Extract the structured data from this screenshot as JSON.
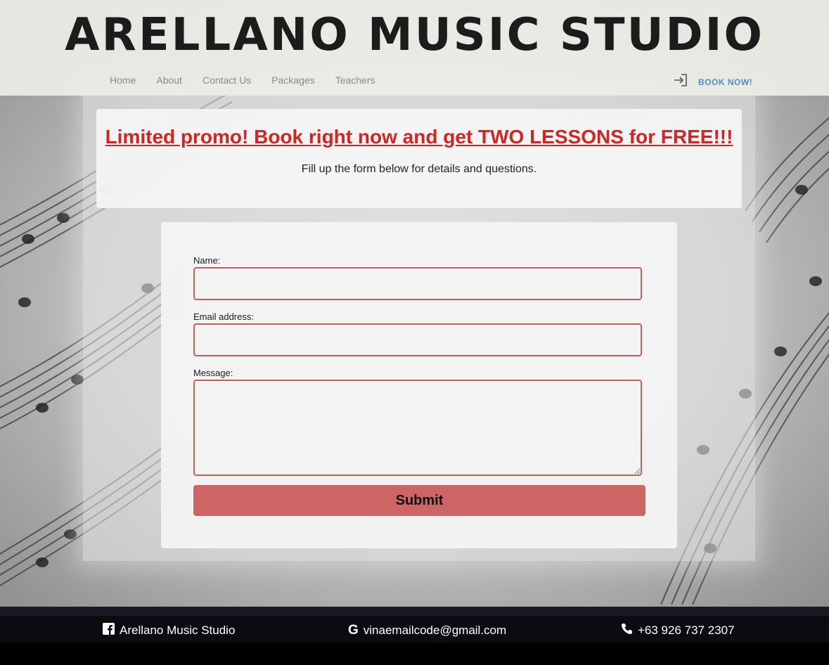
{
  "brand": {
    "title": "ARELLANO MUSIC STUDIO"
  },
  "nav": {
    "items": [
      "Home",
      "About",
      "Contact Us",
      "Packages",
      "Teachers"
    ],
    "book_now": "BOOK NOW!"
  },
  "promo": {
    "title": "Limited promo! Book right now and get TWO LESSONS for FREE!!!",
    "subtitle": "Fill up the form below for details and questions."
  },
  "form": {
    "name_label": "Name:",
    "name_value": "",
    "email_label": "Email address:",
    "email_value": "",
    "message_label": "Message:",
    "message_value": "",
    "submit_label": "Submit"
  },
  "footer": {
    "facebook": "Arellano Music Studio",
    "email": "vinaemailcode@gmail.com",
    "phone": "+63 926 737 2307"
  },
  "colors": {
    "accent_red": "#d42323",
    "field_border": "#cd5c5c",
    "submit_bg": "#cd6565",
    "book_blue": "#4a90c8",
    "footer_bg": "#0b0b12"
  },
  "icons": {
    "book": "login-arrow-icon",
    "facebook": "facebook-icon",
    "email": "google-icon",
    "phone": "phone-icon"
  }
}
